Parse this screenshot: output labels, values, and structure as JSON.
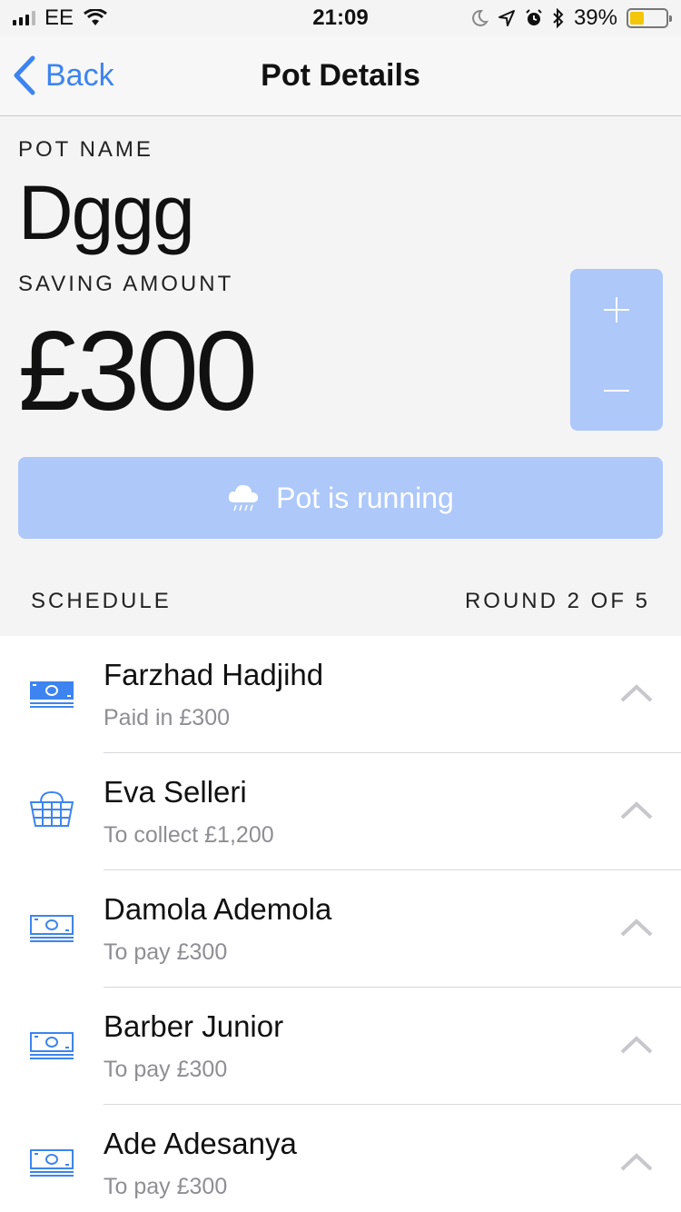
{
  "status_bar": {
    "carrier": "EE",
    "time": "21:09",
    "battery": "39%",
    "battery_level": 0.39,
    "icons": [
      "signal-icon",
      "wifi-icon",
      "moon-icon",
      "location-icon",
      "alarm-icon",
      "bluetooth-icon",
      "battery-icon"
    ]
  },
  "nav": {
    "back_label": "Back",
    "title": "Pot Details"
  },
  "pot": {
    "name_label": "POT NAME",
    "name": "Dggg",
    "amount_label": "SAVING AMOUNT",
    "amount": "£300",
    "status_button": "Pot is running"
  },
  "schedule": {
    "label": "SCHEDULE",
    "round": "ROUND 2 OF 5",
    "items": [
      {
        "name": "Farzhad Hadjihd",
        "detail": "Paid in £300",
        "icon": "banknote-icon"
      },
      {
        "name": "Eva Selleri",
        "detail": "To collect £1,200",
        "icon": "basket-icon"
      },
      {
        "name": "Damola Ademola",
        "detail": "To pay £300",
        "icon": "banknote-icon"
      },
      {
        "name": "Barber Junior",
        "detail": "To pay £300",
        "icon": "banknote-icon"
      },
      {
        "name": "Ade Adesanya",
        "detail": "To pay £300",
        "icon": "banknote-icon"
      }
    ]
  },
  "colors": {
    "accent": "#3d84f0",
    "button_bg": "#adc8f9",
    "battery": "#f4c60a"
  }
}
